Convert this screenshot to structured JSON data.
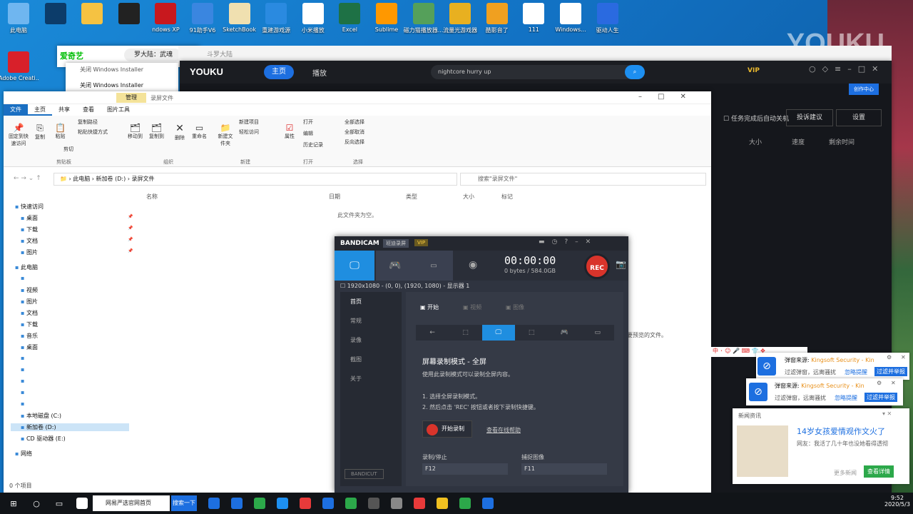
{
  "desktop": {
    "icons": [
      {
        "label": "此电脑",
        "color": "#6fb6f0"
      },
      {
        "label": "Adobe Creati...",
        "color": "#d8202a"
      },
      {
        "label": "",
        "color": "#0c3c6a"
      },
      {
        "label": "",
        "color": "#f5c242"
      },
      {
        "label": "",
        "color": "#222222"
      },
      {
        "label": "ndows XP",
        "color": "#c8181e"
      },
      {
        "label": "91助手V6",
        "color": "#3a86e0"
      },
      {
        "label": "SketchBook",
        "color": "#f0e0b0"
      },
      {
        "label": "重建游戏源",
        "color": "#2a8ae0"
      },
      {
        "label": "小米播放",
        "color": "#ffffff"
      },
      {
        "label": "Excel",
        "color": "#1e7145"
      },
      {
        "label": "Sublime",
        "color": "#ff9800"
      },
      {
        "label": "磁力猫播放器...",
        "color": "#55a05a"
      },
      {
        "label": "流量光游戏器",
        "color": "#e8b020"
      },
      {
        "label": "酷影音了",
        "color": "#f0a020"
      },
      {
        "label": "111",
        "color": "#ffffff"
      },
      {
        "label": "Windows...",
        "color": "#ffffff"
      },
      {
        "label": "驱动人生",
        "color": "#2a6ae0"
      }
    ],
    "watermark": "YOUKU"
  },
  "iqiyi": {
    "logo": "爱奇艺",
    "tab": "罗大陆：武魂",
    "search": "斗罗大陆"
  },
  "installer": {
    "items": [
      "关闭 Windows Installer",
      "关闭 Windows Installer"
    ]
  },
  "youku": {
    "logo": "YOUKU",
    "home": "主页",
    "play": "播放",
    "search_value": "nightcore hurry up",
    "vip": "VIP",
    "badge": "创作中心",
    "auto_shutdown": "任务完成后自动关机",
    "feedback": "投诉建议",
    "settings": "设置",
    "columns": [
      "大小",
      "速度",
      "剩余时间"
    ]
  },
  "explorer": {
    "manage_tab": "管理",
    "title": "录屏文件",
    "tabs": [
      "文件",
      "主页",
      "共享",
      "查看",
      "图片工具"
    ],
    "ribbon": {
      "pin": "固定到快速访问",
      "copy": "复制",
      "paste": "粘贴",
      "copy_path": "复制路径",
      "paste_shortcut": "粘贴快捷方式",
      "cut": "剪切",
      "move_to": "移动到",
      "copy_to": "复制到",
      "delete": "删除",
      "rename": "重命名",
      "new_folder": "新建文件夹",
      "new_item": "新建项目",
      "easy_access": "轻松访问",
      "properties": "属性",
      "open": "打开",
      "edit": "编辑",
      "history": "历史记录",
      "select_all": "全部选择",
      "select_none": "全部取消",
      "invert": "反向选择",
      "groups": [
        "剪贴板",
        "组织",
        "新建",
        "打开",
        "选择"
      ]
    },
    "breadcrumb": [
      "此电脑",
      "新加卷 (D:)",
      "录屏文件"
    ],
    "search_placeholder": "搜索\"录屏文件\"",
    "columns": [
      "名称",
      "日期",
      "类型",
      "大小",
      "标记"
    ],
    "empty": "此文件夹为空。",
    "nav": [
      {
        "label": "快速访问",
        "pin": ""
      },
      {
        "label": "桌面",
        "pin": "📌"
      },
      {
        "label": "下载",
        "pin": "📌"
      },
      {
        "label": "文档",
        "pin": "📌"
      },
      {
        "label": "图片",
        "pin": "📌"
      },
      {
        "label": "此电脑",
        "pin": ""
      },
      {
        "label": "",
        "pin": ""
      },
      {
        "label": "视频",
        "pin": ""
      },
      {
        "label": "图片",
        "pin": ""
      },
      {
        "label": "文档",
        "pin": ""
      },
      {
        "label": "下载",
        "pin": ""
      },
      {
        "label": "音乐",
        "pin": ""
      },
      {
        "label": "桌面",
        "pin": ""
      },
      {
        "label": "",
        "pin": ""
      },
      {
        "label": "",
        "pin": ""
      },
      {
        "label": "",
        "pin": ""
      },
      {
        "label": "",
        "pin": ""
      },
      {
        "label": "",
        "pin": ""
      },
      {
        "label": "本地磁盘 (C:)",
        "pin": ""
      },
      {
        "label": "新加卷 (D:)",
        "pin": ""
      },
      {
        "label": "CD 驱动器 (E:)",
        "pin": ""
      },
      {
        "label": "网络",
        "pin": ""
      }
    ],
    "status": "0 个项目",
    "side_text": "要预览的文件。"
  },
  "bandicam": {
    "logo": "BANDICAM",
    "sub": "班迪录屏",
    "vip": "VIP",
    "time": "00:00:00",
    "size": "0 bytes / 584.0GB",
    "rec": "REC",
    "region": "1920x1080 - (0, 0), (1920, 1080) - 显示器 1",
    "side": [
      "首页",
      "常规",
      "录像",
      "截图",
      "关于"
    ],
    "tabs": [
      "开始",
      "视频",
      "图像"
    ],
    "mode_title": "屏幕录制模式 - 全屏",
    "mode_desc": "使用此录制模式可以录制全屏内容。",
    "steps": [
      "1. 选择全屏录制模式。",
      "2. 然后点击 'REC' 按钮或者按下录制快捷键。"
    ],
    "start_rec": "开始录制",
    "help": "查看在线帮助",
    "hotkey_label1": "录制/停止",
    "hotkey_label2": "捕捉图像",
    "hotkey1": "F12",
    "hotkey2": "F11",
    "bandicut": "BANDICUT"
  },
  "toasts": {
    "source_label": "弹窗来源:",
    "source_value": "Kingsoft Security - Kin",
    "filtered": "过滤弹窗，远离骚扰",
    "reminder": "忽略提醒",
    "filter_btn": "过滤并举报",
    "news_header": "新闻资讯",
    "news_title": "14岁女孩爱情观作文火了",
    "news_desc": "网友：我活了几十年也没她看得透彻",
    "more": "更多新闻",
    "detail": "查看详情",
    "sogou": "中"
  },
  "taskbar": {
    "browser_label": "网易严选官网首页",
    "search_btn": "搜索一下",
    "time": "9:52",
    "date": "2020/5/3"
  }
}
